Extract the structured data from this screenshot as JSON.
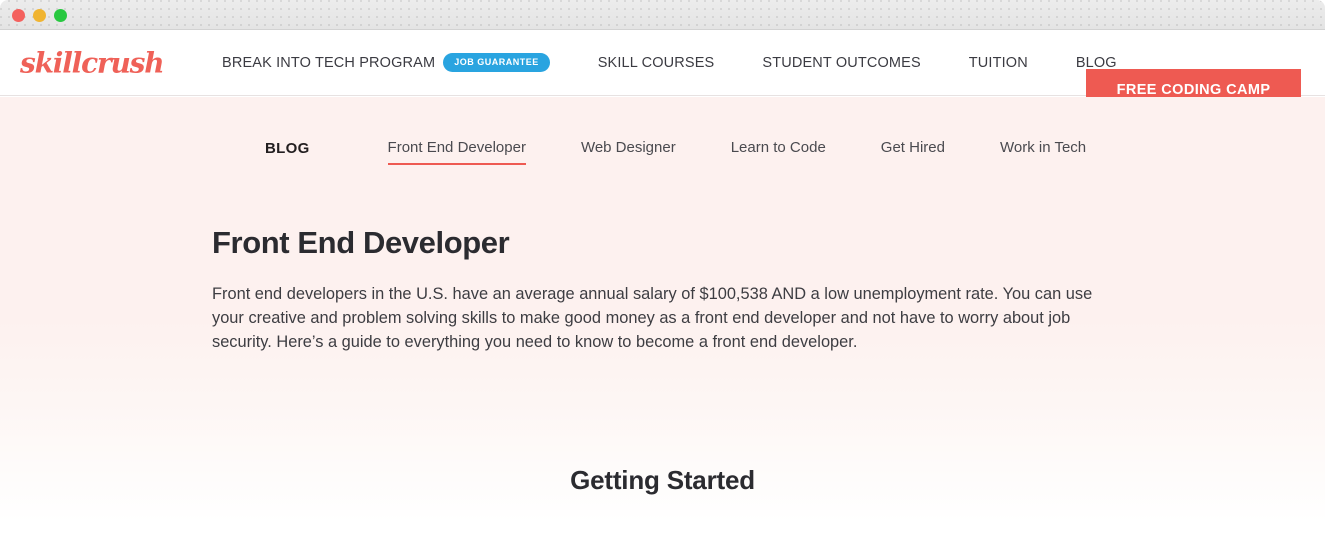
{
  "window": {
    "traffic_lights": [
      {
        "name": "close",
        "color": "#f4615e"
      },
      {
        "name": "minimize",
        "color": "#f0b431"
      },
      {
        "name": "zoom",
        "color": "#28c840"
      }
    ]
  },
  "brand": {
    "logo_text": "skillcrush",
    "accent_color": "#ee5a52",
    "badge_color": "#29a4e0"
  },
  "header": {
    "nav": {
      "break_into_tech": "BREAK INTO TECH PROGRAM",
      "job_guarantee_badge": "JOB GUARANTEE",
      "skill_courses": "SKILL COURSES",
      "student_outcomes": "STUDENT OUTCOMES",
      "tuition": "TUITION",
      "blog": "BLOG"
    },
    "cta_label": "FREE CODING CAMP"
  },
  "subnav": {
    "title": "BLOG",
    "tabs": [
      {
        "label": "Front End Developer",
        "active": true
      },
      {
        "label": "Web Designer",
        "active": false
      },
      {
        "label": "Learn to Code",
        "active": false
      },
      {
        "label": "Get Hired",
        "active": false
      },
      {
        "label": "Work in Tech",
        "active": false
      }
    ]
  },
  "hero": {
    "title": "Front End Developer",
    "body": "Front end developers in the U.S. have an average annual salary of $100,538 AND a low unemployment rate. You can use your creative and problem solving skills to make good money as a front end developer and not have to worry about job security. Here’s a guide to everything you need to know to become a front end developer.",
    "salary": "$100,538"
  },
  "section": {
    "getting_started_title": "Getting Started"
  }
}
